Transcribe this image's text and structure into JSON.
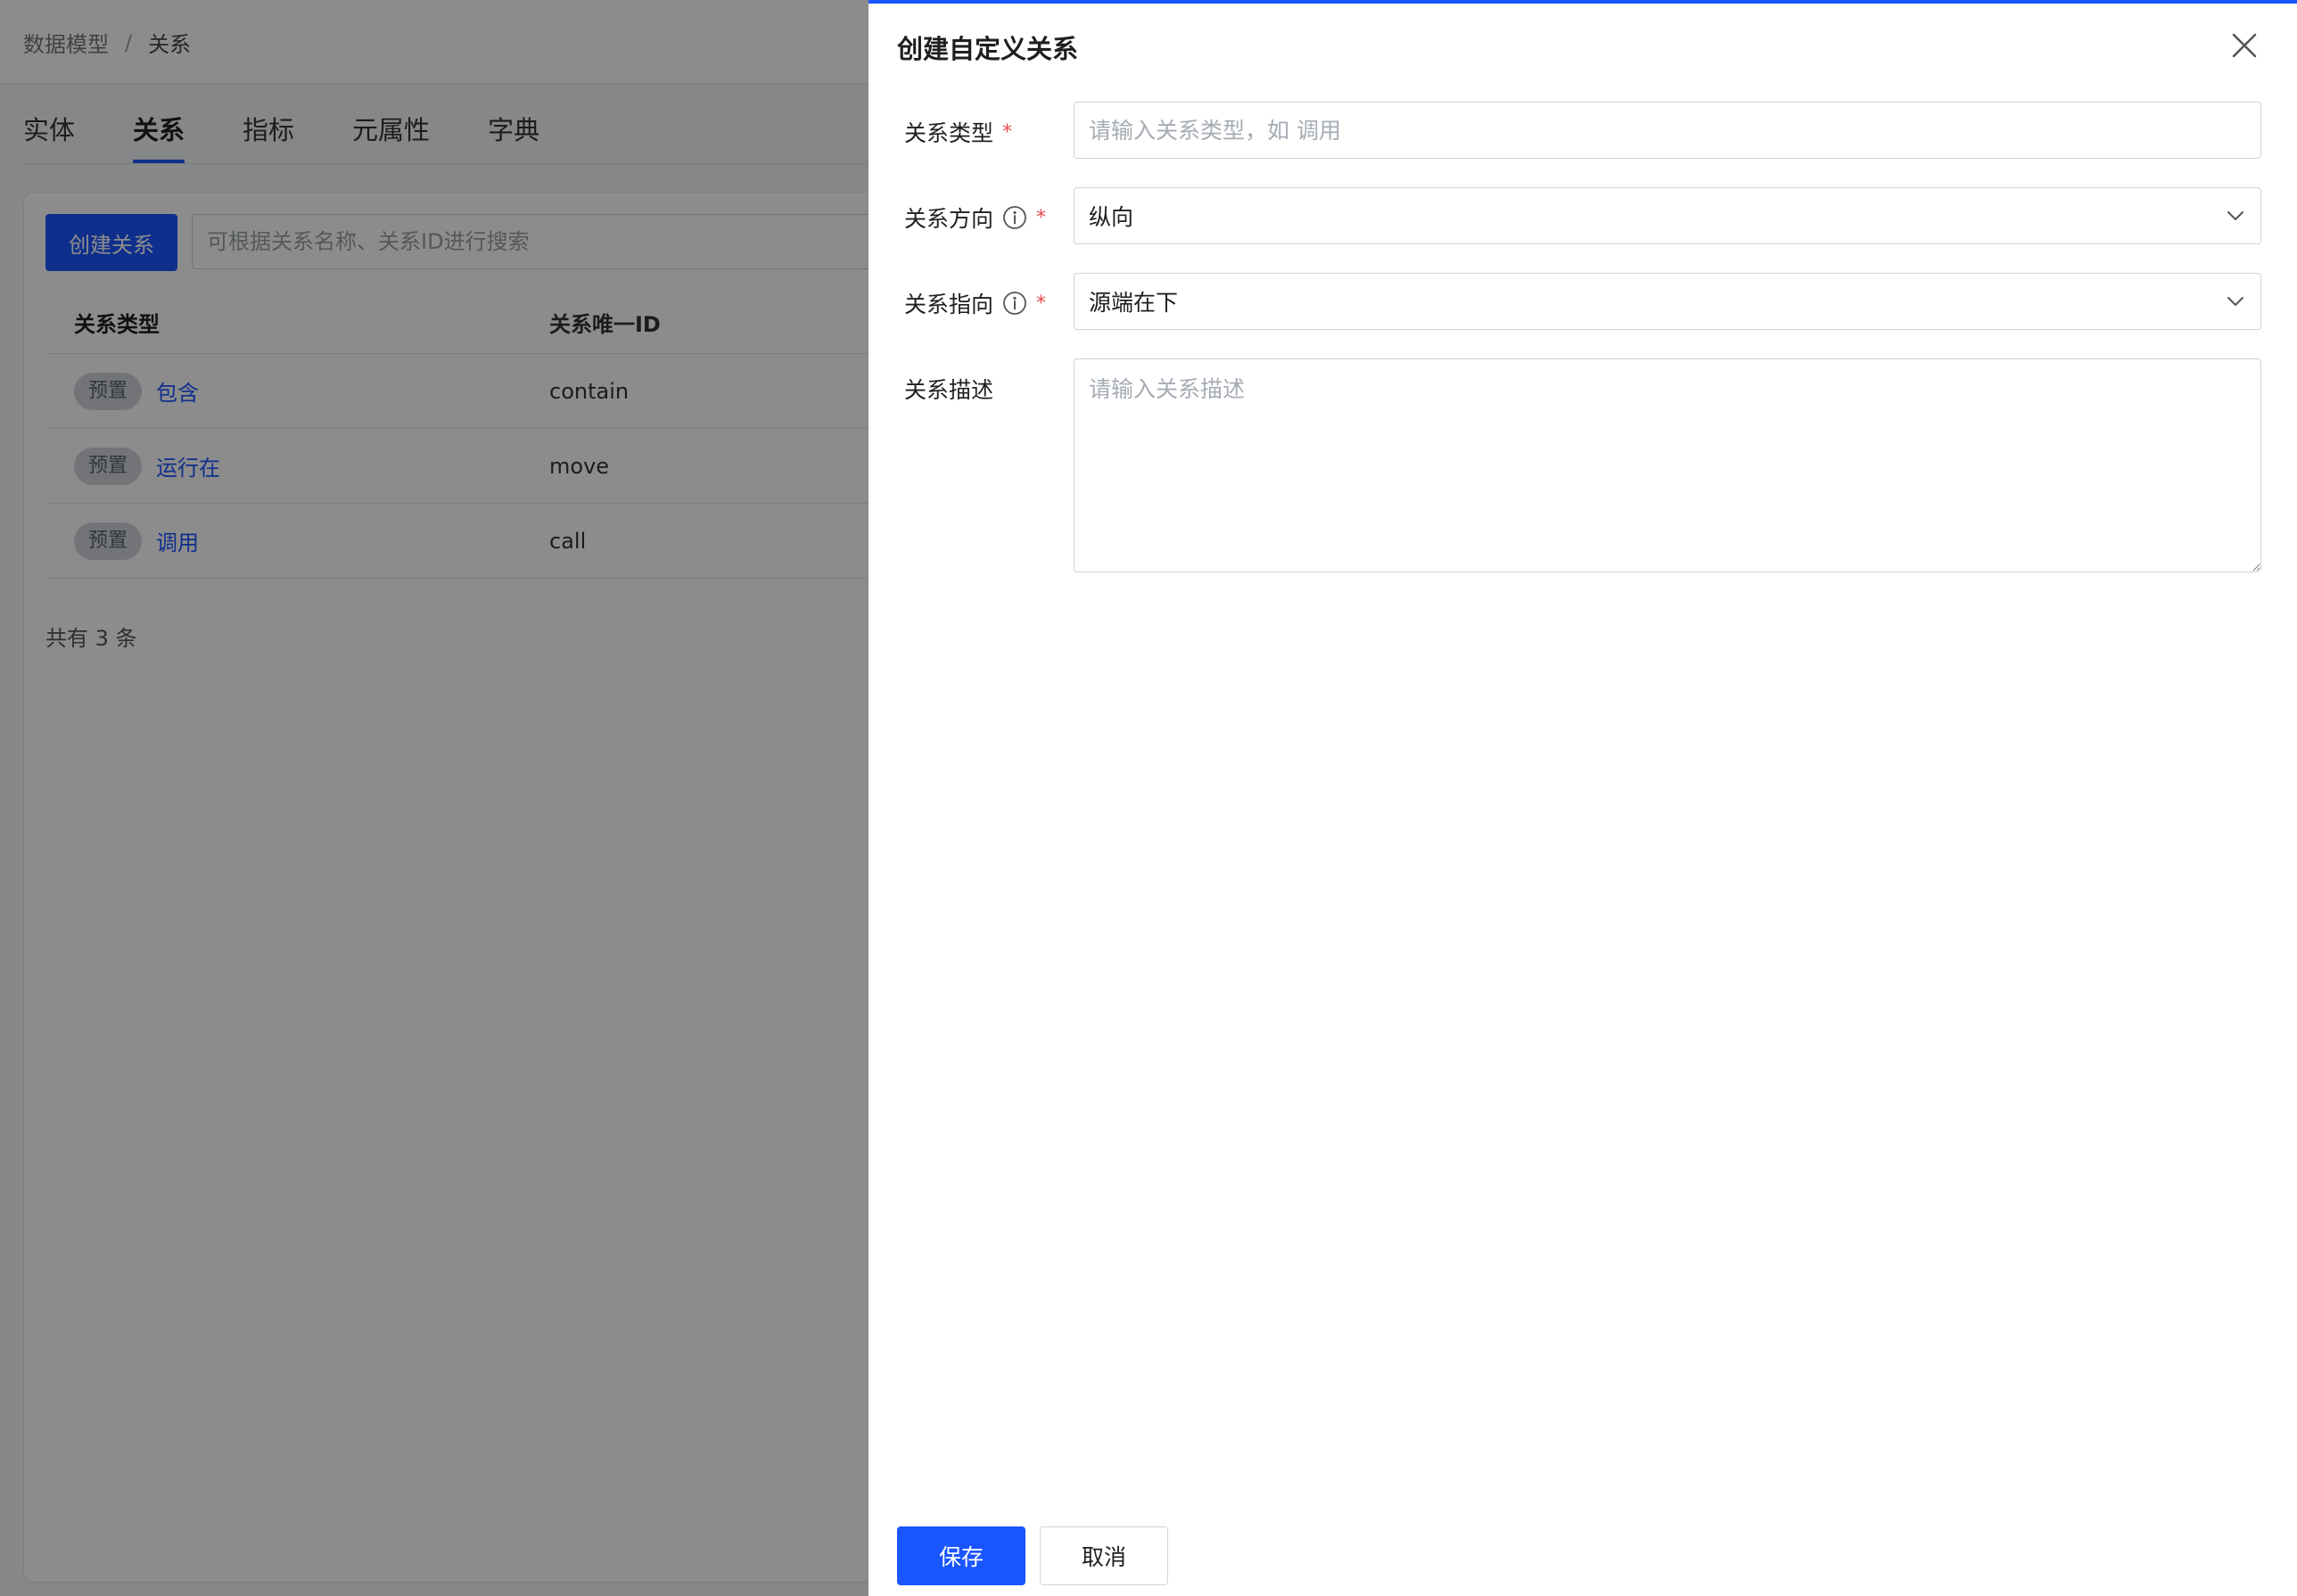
{
  "breadcrumb": {
    "root": "数据模型",
    "separator": "/",
    "current": "关系"
  },
  "tabs": [
    {
      "label": "实体",
      "active": false
    },
    {
      "label": "关系",
      "active": true
    },
    {
      "label": "指标",
      "active": false
    },
    {
      "label": "元属性",
      "active": false
    },
    {
      "label": "字典",
      "active": false
    }
  ],
  "toolbar": {
    "create_label": "创建关系",
    "search_placeholder": "可根据关系名称、关系ID进行搜索"
  },
  "table": {
    "headers": [
      "关系类型",
      "关系唯一ID"
    ],
    "rows": [
      {
        "badge": "预置",
        "name": "包含",
        "id": "contain"
      },
      {
        "badge": "预置",
        "name": "运行在",
        "id": "move"
      },
      {
        "badge": "预置",
        "name": "调用",
        "id": "call"
      }
    ]
  },
  "total_text": "共有 3 条",
  "drawer": {
    "title": "创建自定义关系",
    "close_icon": "close-icon",
    "fields": {
      "type": {
        "label": "关系类型",
        "required_mark": "*",
        "placeholder": "请输入关系类型，如 调用",
        "value": ""
      },
      "direction": {
        "label": "关系方向",
        "required_mark": "*",
        "value": "纵向"
      },
      "pointing": {
        "label": "关系指向",
        "required_mark": "*",
        "value": "源端在下"
      },
      "description": {
        "label": "关系描述",
        "placeholder": "请输入关系描述",
        "value": ""
      }
    },
    "save_label": "保存",
    "cancel_label": "取消"
  },
  "colors": {
    "accent": "#1a56ff",
    "required": "#e5484d",
    "overlay": "rgba(0,0,0,0.45)"
  }
}
